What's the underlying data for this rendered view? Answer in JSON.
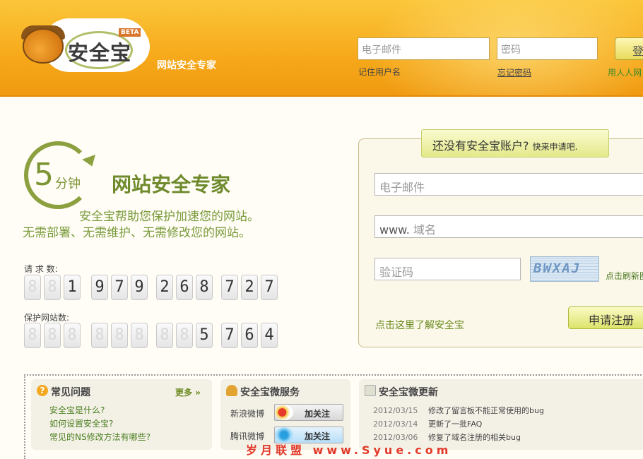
{
  "header": {
    "logo_text": "安全宝",
    "logo_badge": "BETA",
    "tagline": "网站安全专家",
    "email_placeholder": "电子邮件",
    "password_placeholder": "密码",
    "login_label": "登",
    "remember_label": "记住用户名",
    "forgot_label": "忘记密码",
    "renren_label": "用人人网"
  },
  "hero": {
    "badge_number": "5",
    "badge_unit": "分钟",
    "title": "网站安全专家",
    "line1": "安全宝帮助您保护加速您的网站。",
    "line2": "无需部署、无需维护、无需修改您的网站。"
  },
  "counters": {
    "requests_label": "请 求 数:",
    "requests_digits": [
      "8",
      "8",
      "1",
      "9",
      "7",
      "9",
      "2",
      "6",
      "8",
      "7",
      "2",
      "7"
    ],
    "requests_dim": [
      true,
      true,
      false,
      false,
      false,
      false,
      false,
      false,
      false,
      false,
      false,
      false
    ],
    "sites_label": "保护网站数:",
    "sites_digits": [
      "8",
      "8",
      "8",
      "8",
      "8",
      "8",
      "8",
      "8",
      "5",
      "7",
      "6",
      "4"
    ],
    "sites_dim": [
      true,
      true,
      true,
      true,
      true,
      true,
      true,
      true,
      false,
      false,
      false,
      false
    ]
  },
  "register": {
    "banner_main": "还没有安全宝账户?",
    "banner_small": "快来申请吧.",
    "email_placeholder": "电子邮件",
    "domain_prefix": "www.",
    "domain_placeholder": "域名",
    "captcha_placeholder": "验证码",
    "captcha_text": "BWXAJ",
    "refresh_label": "点击刷新图",
    "submit_label": "申请注册",
    "learn_label": "点击这里了解安全宝"
  },
  "faq": {
    "title": "常见问题",
    "icon_glyph": "?",
    "more_label": "更多 »",
    "items": [
      "安全宝是什么?",
      "如何设置安全宝?",
      "常见的NS修改方法有哪些?"
    ]
  },
  "weibo": {
    "title": "安全宝微服务",
    "rows": [
      {
        "label": "新浪微博",
        "button": "加关注"
      },
      {
        "label": "腾讯微博",
        "button": "加关注"
      }
    ]
  },
  "updates": {
    "title": "安全宝微更新",
    "rows": [
      {
        "date": "2012/03/15",
        "text": "修改了留言板不能正常使用的bug"
      },
      {
        "date": "2012/03/14",
        "text": "更新了一批FAQ"
      },
      {
        "date": "2012/03/06",
        "text": "修复了域名注册的相关bug"
      }
    ]
  },
  "watermark": "岁月联盟 www.Syue.com",
  "colors": {
    "header_orange": "#f6a91a",
    "brand_green": "#7c9434",
    "link_green": "#4b7f20"
  }
}
